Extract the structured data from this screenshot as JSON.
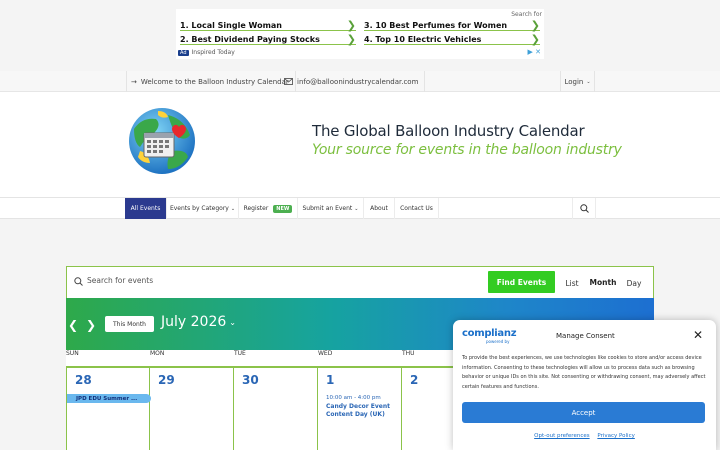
{
  "ad": {
    "search_for": "Search for",
    "items": [
      "1. Local Single Woman",
      "3. 10 Best Perfumes for Women",
      "2. Best Dividend Paying Stocks",
      "4. Top 10 Electric Vehicles"
    ],
    "badge": "Ad",
    "footer": "Inspired Today"
  },
  "topbar": {
    "welcome": "Welcome to the  Balloon  Industry Calendar",
    "email": "info@balloonindustrycalendar.com",
    "login": "Login"
  },
  "header": {
    "title": "The Global  Balloon  Industry Calendar",
    "tagline": "Your source for events in the balloon industry"
  },
  "nav": {
    "items": [
      {
        "label": "All  Events"
      },
      {
        "label": "Events by Category"
      },
      {
        "label": "Register"
      },
      {
        "label": "Submit an  Event"
      },
      {
        "label": "About"
      },
      {
        "label": "Contact Us"
      }
    ],
    "new_badge": "NEW"
  },
  "search": {
    "placeholder": "Search for events",
    "button": "Find Events",
    "views": [
      "List",
      "Month",
      "Day"
    ]
  },
  "calendar": {
    "this_month": "This Month",
    "month_label": "July 2026",
    "day_names": [
      "SUN",
      "MON",
      "TUE",
      "WED",
      "THU"
    ],
    "days": [
      "28",
      "29",
      "30",
      "1",
      "2"
    ],
    "event_pill": "JPD EDU Summer ...",
    "event_time": "10:00 am - 4:00 pm",
    "event_title": "Candy Decor Event Content Day (UK)"
  },
  "consent": {
    "logo": "complianz",
    "logo_sub": "powered by",
    "title": "Manage Consent",
    "text": "To provide the best experiences, we use technologies like cookies to store and/or access device information. Consenting to these technologies will allow us to process data such as browsing behavior or unique IDs on this site. Not consenting or withdrawing consent, may adversely affect certain features and functions.",
    "accept": "Accept",
    "link1": "Opt-out preferences",
    "link2": "Privacy Policy"
  },
  "colors": {
    "brand_green": "#7cbf3f",
    "nav_active": "#2b3a8f",
    "find_button": "#33cc22",
    "accept_button": "#2a7bd4"
  }
}
